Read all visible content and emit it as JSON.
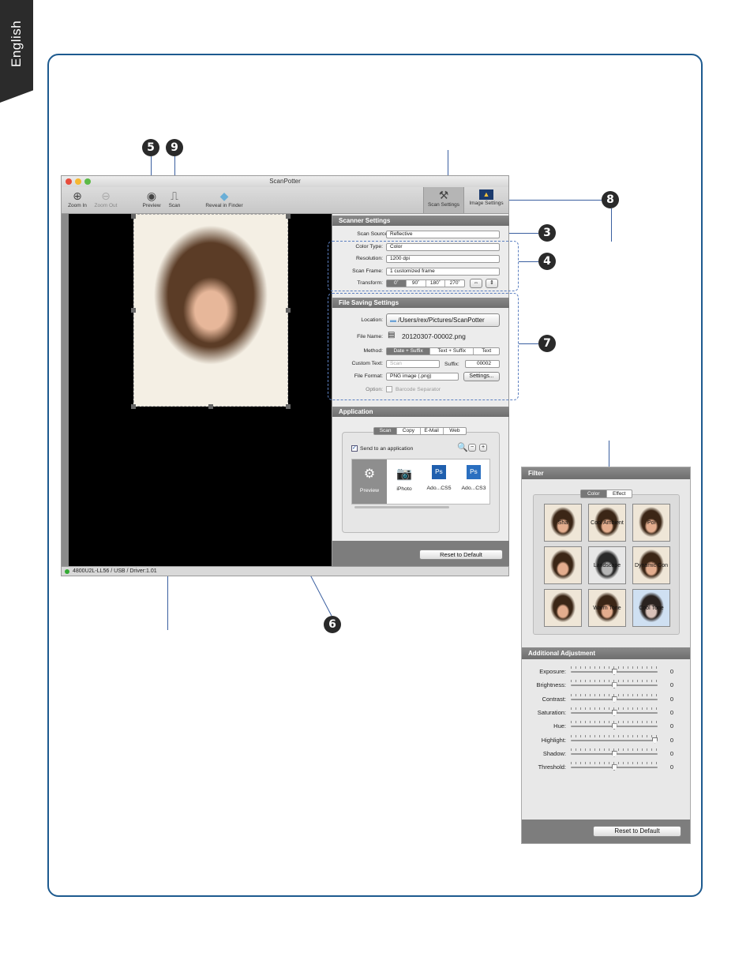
{
  "language_tab": "English",
  "callouts": {
    "c3": "3",
    "c4": "4",
    "c5": "5",
    "c6": "6",
    "c7": "7",
    "c8": "8",
    "c9": "9"
  },
  "window": {
    "title": "ScanPotter",
    "toolbar": {
      "zoom_in": "Zoom In",
      "zoom_out": "Zoom Out",
      "preview": "Preview",
      "scan": "Scan",
      "reveal": "Reveal in Finder",
      "scan_settings": "Scan Settings",
      "image_settings": "Image Settings"
    },
    "status": "4800U2L-LL56 / USB / Driver:1.01",
    "scanner_settings": {
      "header": "Scanner Settings",
      "scan_source_label": "Scan Source:",
      "scan_source": "Reflective",
      "color_type_label": "Color Type:",
      "color_type": "Color",
      "resolution_label": "Resolution:",
      "resolution": "1200 dpi",
      "scan_frame_label": "Scan Frame:",
      "scan_frame": "1 customized frame",
      "transform_label": "Transform:",
      "transform_options": [
        "0˚",
        "90˚",
        "180˚",
        "270˚"
      ]
    },
    "file_saving": {
      "header": "File Saving Settings",
      "location_label": "Location:",
      "location": "/Users/rex/Pictures/ScanPotter",
      "file_name_label": "File Name:",
      "file_name": "20120307-00002.png",
      "method_label": "Method:",
      "method_options": [
        "Date + Suffix",
        "Text + Suffix",
        "Text"
      ],
      "custom_text_label": "Custom Text:",
      "custom_text_placeholder": "Scan",
      "suffix_label": "Suffix:",
      "suffix": "00002",
      "file_format_label": "File Format:",
      "file_format": "PNG image (.png)",
      "settings_button": "Settings...",
      "option_label": "Option:",
      "barcode": "Barcode Separator"
    },
    "application": {
      "header": "Application",
      "tabs": [
        "Scan",
        "Copy",
        "E-Mail",
        "Web"
      ],
      "send_label": "Send to an application",
      "apps": [
        "Preview",
        "iPhoto",
        "Ado...CS5",
        "Ado...CS3"
      ],
      "ps_glyph": "Ps",
      "reset": "Reset to Default"
    }
  },
  "filter_panel": {
    "header": "Filter",
    "tabs": [
      "Color",
      "Effect"
    ],
    "thumb_labels": [
      "Sha",
      "Cool Ambient",
      "Poi",
      "",
      "Landscape",
      "Dynamic Con",
      "",
      "Warm Tone",
      "Cool Tone"
    ],
    "adj_header": "Additional Adjustment",
    "adjustments": [
      {
        "label": "Exposure:",
        "value": "0",
        "pos": 0.5
      },
      {
        "label": "Brightness:",
        "value": "0",
        "pos": 0.5
      },
      {
        "label": "Contrast:",
        "value": "0",
        "pos": 0.5
      },
      {
        "label": "Saturation:",
        "value": "0",
        "pos": 0.5
      },
      {
        "label": "Hue:",
        "value": "0",
        "pos": 0.5
      },
      {
        "label": "Highlight:",
        "value": "0",
        "pos": 1.0
      },
      {
        "label": "Shadow:",
        "value": "0",
        "pos": 0.5
      },
      {
        "label": "Threshold:",
        "value": "0",
        "pos": 0.5
      }
    ],
    "reset": "Reset to Default"
  },
  "colors": {
    "frame_border": "#1d5a8f",
    "callout_line": "#3a5fa0",
    "section_header": "#7a7a7a"
  }
}
